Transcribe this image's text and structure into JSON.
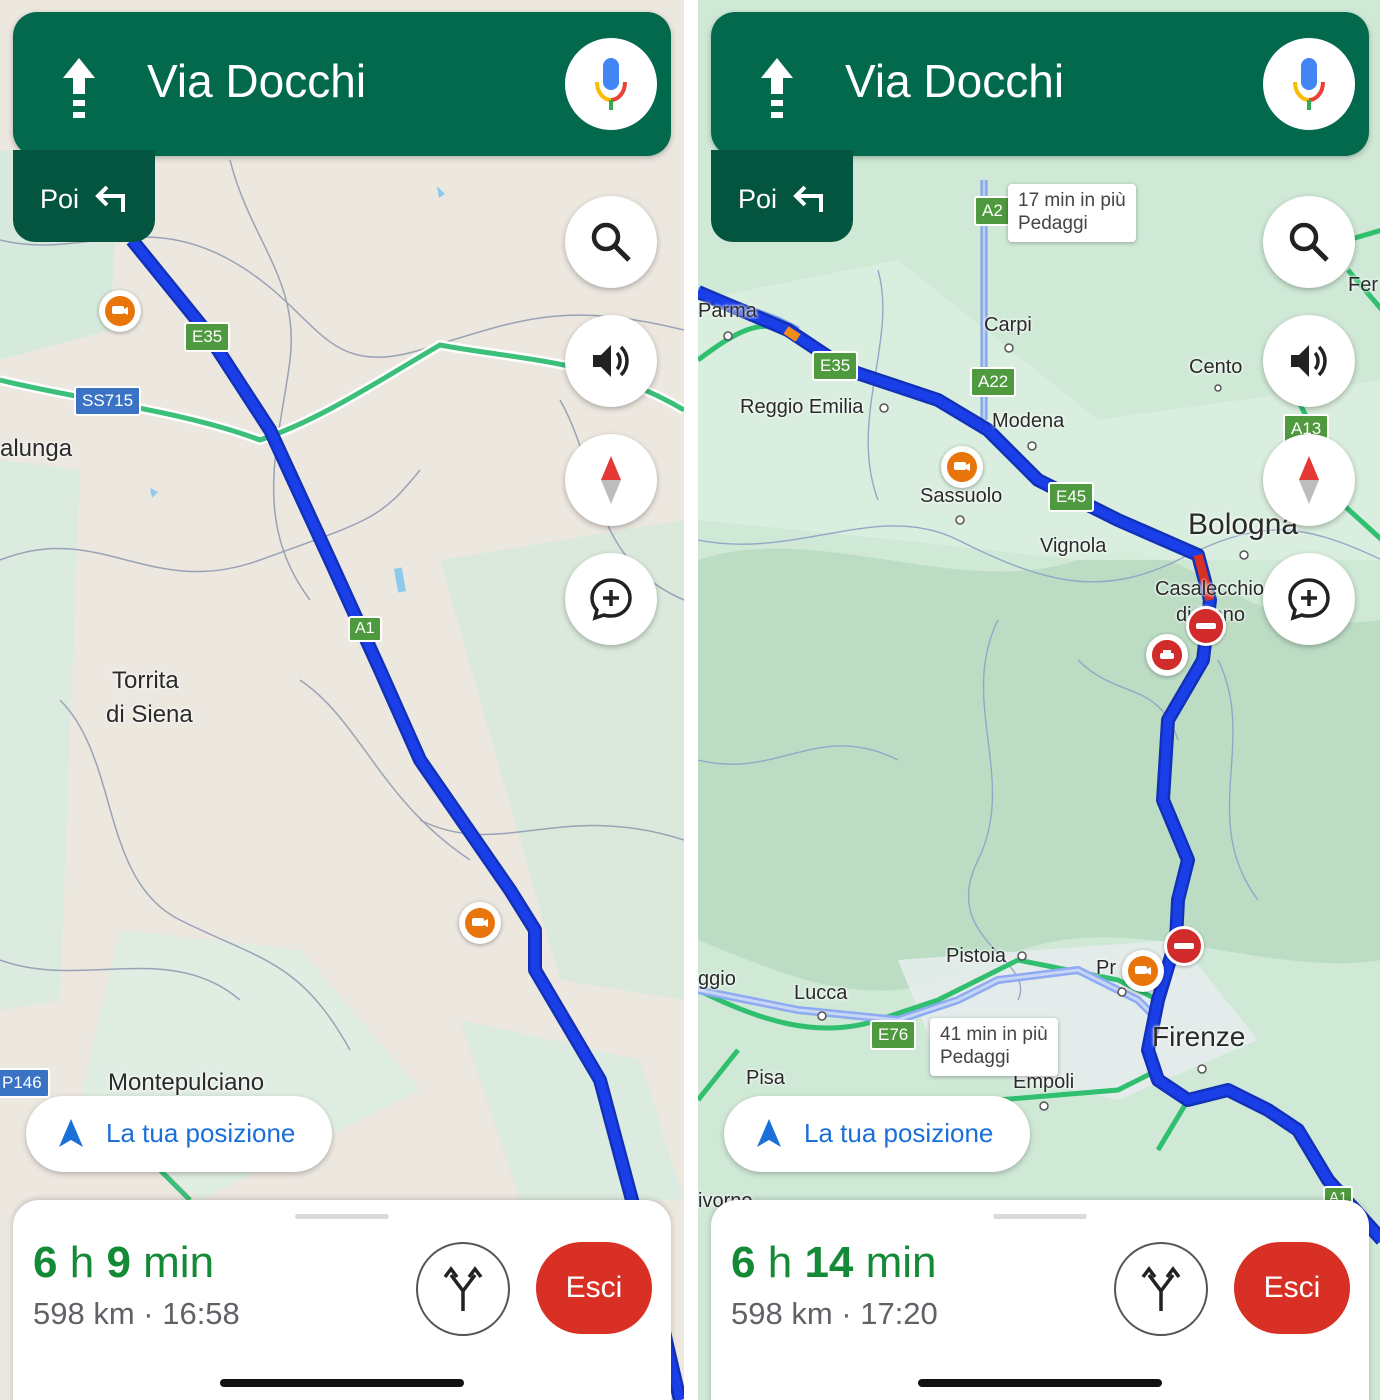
{
  "colors": {
    "banner": "#03694d",
    "banner_secondary": "#03553f",
    "route": "#1a3fe8",
    "eta_green": "#138a36",
    "exit_red": "#d93025",
    "link_blue": "#1a6fd8"
  },
  "screens": [
    {
      "instruction": {
        "direction_icon": "arrow-up-icon",
        "street": "Via Docchi"
      },
      "next_step": {
        "label": "Poi",
        "icon": "turn-left-icon"
      },
      "controls": [
        "search-icon",
        "volume-icon",
        "compass-icon",
        "add-report-icon"
      ],
      "recenter_label": "La tua posizione",
      "summary": {
        "duration_hours": "6",
        "duration_h_unit": "h",
        "duration_minutes": "9",
        "duration_min_unit": "min",
        "details": "598 km · 16:58"
      },
      "exit_label": "Esci",
      "map": {
        "places": {
          "torrita": "Torrita",
          "torrita2": "di Siena",
          "montepulciano": "Montepulciano",
          "alunga": "alunga"
        },
        "shields": {
          "e35": "E35",
          "ss715": "SS715",
          "a1": "A1",
          "p146": "P146"
        }
      }
    },
    {
      "instruction": {
        "direction_icon": "arrow-up-icon",
        "street": "Via Docchi"
      },
      "next_step": {
        "label": "Poi",
        "icon": "turn-left-icon"
      },
      "controls": [
        "search-icon",
        "volume-icon",
        "compass-icon",
        "add-report-icon"
      ],
      "recenter_label": "La tua posizione",
      "summary": {
        "duration_hours": "6",
        "duration_h_unit": "h",
        "duration_minutes": "14",
        "duration_min_unit": "min",
        "details": "598 km · 17:20"
      },
      "exit_label": "Esci",
      "map": {
        "places": {
          "parma": "Parma",
          "carpi": "Carpi",
          "reggio": "Reggio Emilia",
          "modena": "Modena",
          "cento": "Cento",
          "sassuolo": "Sassuolo",
          "vignola": "Vignola",
          "bologna": "Bologna",
          "casalecchio": "Casalecchio",
          "casalecchio2": "di Reno",
          "pistoia": "Pistoia",
          "prato": "Pr",
          "lucca": "Lucca",
          "firenze": "Firenze",
          "empoli": "Empoli",
          "pisa": "Pisa",
          "ggio": "ggio",
          "livorno": "ivorno",
          "fer": "Fer"
        },
        "shields": {
          "a22_top": "A2",
          "e35": "E35",
          "a22": "A22",
          "a13": "A13",
          "e45": "E45",
          "e76": "E76",
          "a1": "A1"
        },
        "callouts": [
          {
            "time": "17 min in più",
            "tolls": "Pedaggi"
          },
          {
            "time": "41 min in più",
            "tolls": "Pedaggi"
          }
        ]
      }
    }
  ]
}
